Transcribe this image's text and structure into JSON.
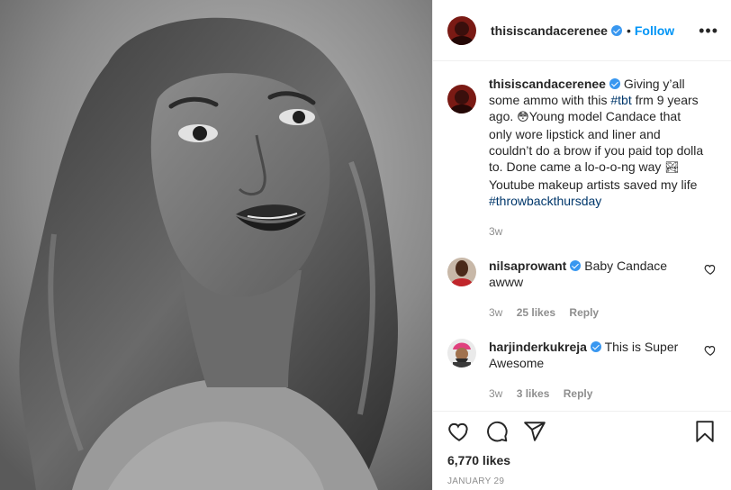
{
  "post": {
    "username": "thisiscandacerenee",
    "separator": "•",
    "follow_label": "Follow",
    "more_icon": "more-options-icon",
    "caption": {
      "username": "thisiscandacerenee",
      "text_1": "Giving y’all some ammo with this ",
      "hashtag_1": "#tbt",
      "text_2": " frm 9 years ago. ",
      "emoji_1": "😳",
      "text_3": "Young model Candace that only wore lipstick and liner and couldn’t do a brow if you paid top dolla to. Done came a lo-o-o-ng way ",
      "emoji_2": "🏞",
      "text_4": " Youtube makeup artists saved my life ",
      "hashtag_2": "#throwbackthursday",
      "time": "3w"
    },
    "comments": [
      {
        "username": "nilsaprowant",
        "text": "Baby Candace awww",
        "time": "3w",
        "likes": "25 likes",
        "reply": "Reply"
      },
      {
        "username": "harjinderkukreja",
        "text": "This is Super Awesome",
        "time": "3w",
        "likes": "3 likes",
        "reply": "Reply"
      }
    ],
    "likes_count": "6,770 likes",
    "date": "JANUARY 29",
    "colors": {
      "accent": "#0095f6",
      "verified": "#3897f0",
      "hashtag": "#00376b",
      "meta": "#8e8e8e"
    }
  }
}
